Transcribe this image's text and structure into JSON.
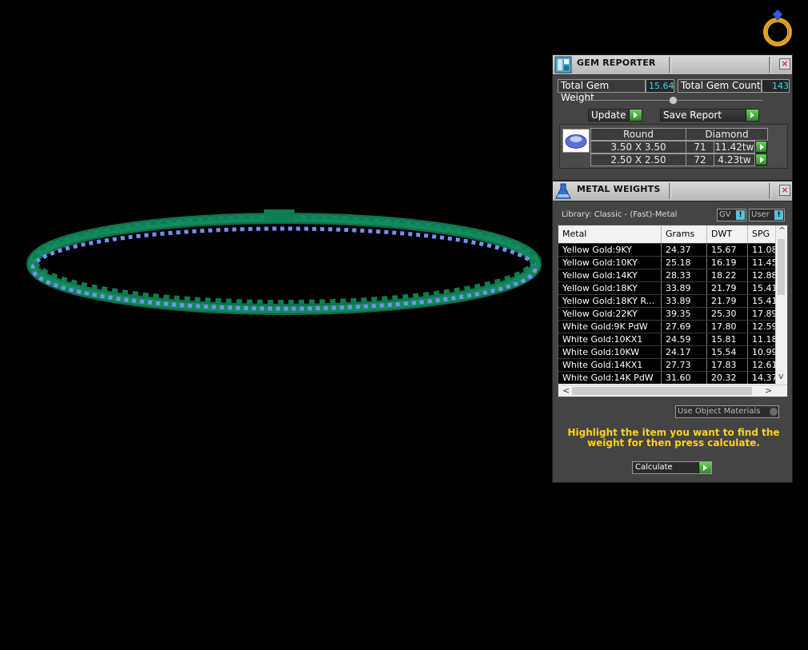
{
  "colors": {
    "ring_metal": "#118a5c",
    "ring_gems": "#7b8ff2",
    "accent_cyan": "#38e0e8",
    "hint_yellow": "#ffd21a",
    "go_green": "#3fae33"
  },
  "viewport": {
    "ring_icon": "ring-diamond-icon"
  },
  "gem_reporter": {
    "title": "GEM REPORTER",
    "close_glyph": "×",
    "total_weight_label": "Total Gem Weight",
    "total_weight_value": "15.64",
    "total_count_label": "Total Gem Count",
    "total_count_value": "143",
    "update_label": "Update",
    "save_report_label": "Save Report",
    "gem_table": {
      "shape_header": "Round",
      "type_header": "Diamond",
      "rows": [
        {
          "size": "3.50 X 3.50",
          "count": "71",
          "weight": "11.42tw"
        },
        {
          "size": "2.50 X 2.50",
          "count": "72",
          "weight": "4.23tw"
        }
      ]
    }
  },
  "metal_weights": {
    "title": "METAL WEIGHTS",
    "close_glyph": "×",
    "library": "Library: Classic - (Fast)-Metal",
    "gv_label": "GV",
    "user_label": "User",
    "info_glyph": "!",
    "columns": [
      "Metal",
      "Grams",
      "DWT",
      "SPG"
    ],
    "rows": [
      [
        "Yellow Gold:9KY",
        "24.37",
        "15.67",
        "11.08"
      ],
      [
        "Yellow Gold:10KY",
        "25.18",
        "16.19",
        "11.45"
      ],
      [
        "Yellow Gold:14KY",
        "28.33",
        "18.22",
        "12.88"
      ],
      [
        "Yellow Gold:18KY",
        "33.89",
        "21.79",
        "15.41"
      ],
      [
        "Yellow Gold:18KY R...",
        "33.89",
        "21.79",
        "15.41"
      ],
      [
        "Yellow Gold:22KY",
        "39.35",
        "25.30",
        "17.89"
      ],
      [
        "White Gold:9K PdW",
        "27.69",
        "17.80",
        "12.59"
      ],
      [
        "White Gold:10KX1",
        "24.59",
        "15.81",
        "11.18"
      ],
      [
        "White Gold:10KW",
        "24.17",
        "15.54",
        "10.99"
      ],
      [
        "White Gold:14KX1",
        "27.73",
        "17.83",
        "12.61"
      ],
      [
        "White Gold:14K PdW",
        "31.60",
        "20.32",
        "14.37"
      ]
    ],
    "scroll_up": "^",
    "scroll_down": "v",
    "scroll_left": "<",
    "scroll_right": ">",
    "use_object_materials": "Use Object Materials",
    "hint": "Highlight the item you want to find the weight for then press calculate.",
    "calculate_label": "Calculate"
  }
}
